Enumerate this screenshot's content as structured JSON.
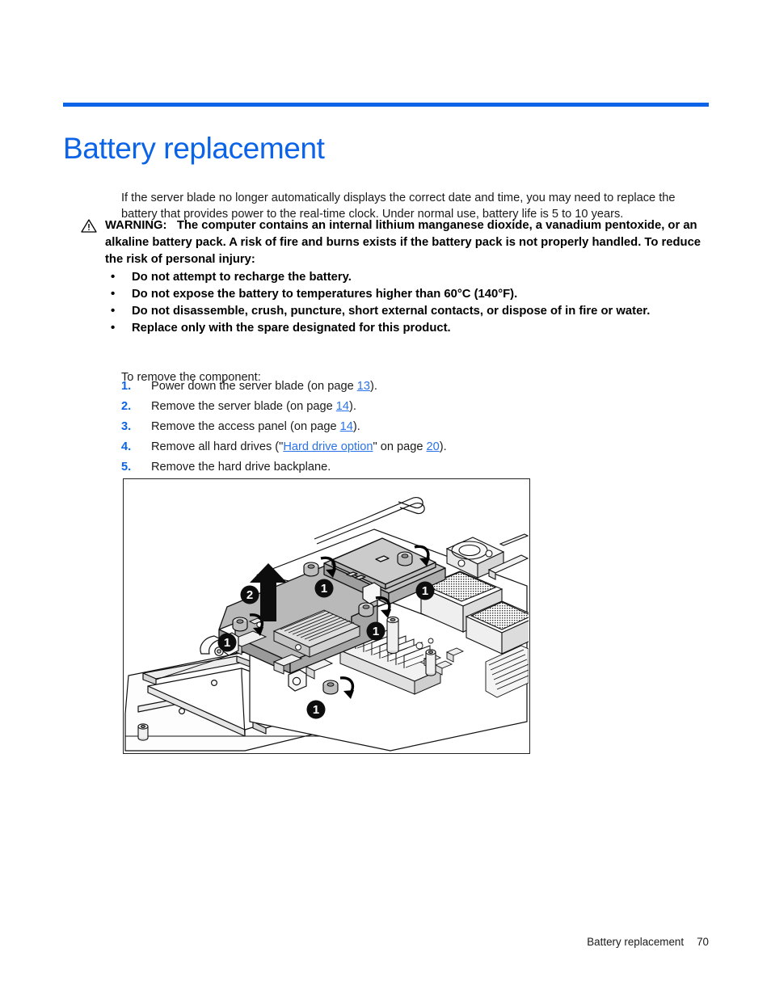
{
  "document": {
    "title": "Battery replacement",
    "accent_color": "#0b63e8",
    "link_color": "#2a72e8"
  },
  "intro": {
    "text": "If the server blade no longer automatically displays the correct date and time, you may need to replace the battery that provides power to the real-time clock. Under normal use, battery life is 5 to 10 years."
  },
  "warning": {
    "icon": "warning-triangle-icon",
    "label": "WARNING:",
    "body": "The computer contains an internal lithium manganese dioxide, a vanadium pentoxide, or an alkaline battery pack. A risk of fire and burns exists if the battery pack is not properly handled. To reduce the risk of personal injury:",
    "bullet_glyph": "•",
    "items": [
      "Do not attempt to recharge the battery.",
      "Do not expose the battery to temperatures higher than 60°C (140°F).",
      "Do not disassemble, crush, puncture, short external contacts, or dispose of in fire or water.",
      "Replace only with the spare designated for this product."
    ]
  },
  "procedure": {
    "lead_in": "To remove the component:",
    "steps": [
      {
        "number": "1.",
        "pre": "Power down the server blade (on page ",
        "link": "13",
        "post": ")."
      },
      {
        "number": "2.",
        "pre": "Remove the server blade (on page ",
        "link": "14",
        "post": ")."
      },
      {
        "number": "3.",
        "pre": "Remove the access panel (on page ",
        "link": "14",
        "post": ")."
      },
      {
        "number": "4.",
        "pre": "Remove all hard drives (\"",
        "link": "Hard drive option",
        "mid": "\" on page ",
        "link2": "20",
        "post": ")."
      },
      {
        "number": "5.",
        "pre": "Remove the hard drive backplane.",
        "link": "",
        "post": ""
      }
    ]
  },
  "figure": {
    "name": "hard-drive-backplane-removal-illustration",
    "callouts": [
      {
        "label": "1",
        "meaning": "loosen thumbscrews"
      },
      {
        "label": "2",
        "meaning": "lift backplane straight up"
      }
    ],
    "callout_count_one": 5,
    "callout_count_two": 1
  },
  "footer": {
    "section": "Battery replacement",
    "page_number": "70"
  }
}
